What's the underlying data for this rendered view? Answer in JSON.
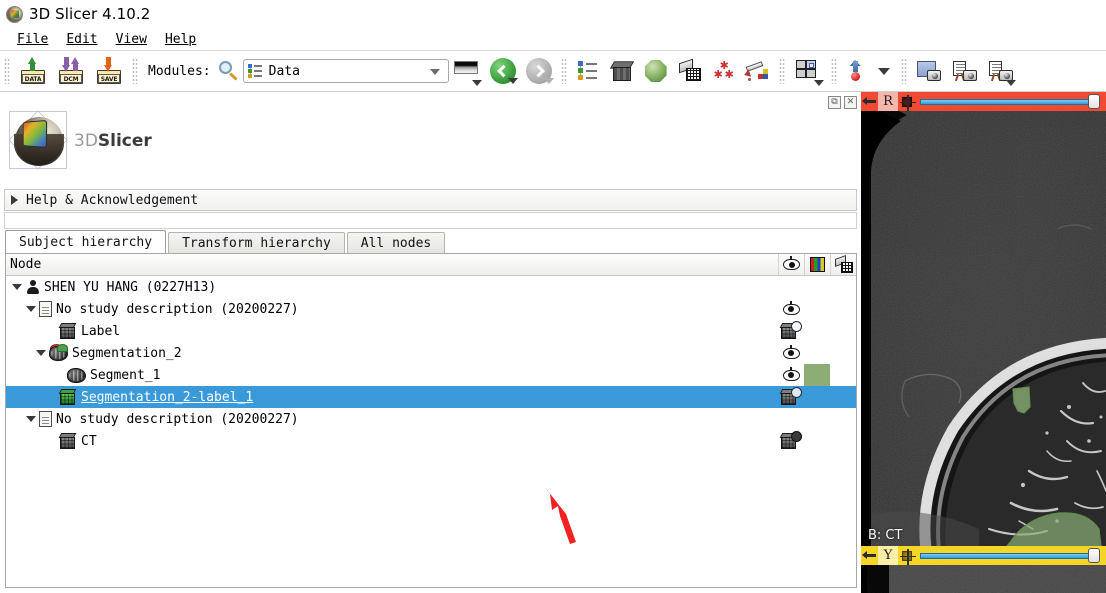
{
  "window": {
    "title": "3D Slicer 4.10.2",
    "app_icon": "slicer-logo-icon"
  },
  "menubar": {
    "items": [
      {
        "label": "File",
        "mnemonic": "F"
      },
      {
        "label": "Edit",
        "mnemonic": "E"
      },
      {
        "label": "View",
        "mnemonic": "V"
      },
      {
        "label": "Help",
        "mnemonic": "H"
      }
    ]
  },
  "toolbar": {
    "load_data_label": "DATA",
    "load_dicom_label": "DCM",
    "save_data_label": "SAVE",
    "modules_label": "Modules:",
    "search_icon": "magnifier-icon",
    "module_selector": {
      "value": "Data",
      "icon": "subject-hierarchy-icon"
    },
    "icons": [
      "colormap-gradient-icon",
      "module-previous-icon",
      "module-next-icon",
      "subject-hierarchy-icon",
      "volume-rendering-icon",
      "models-icon",
      "transforms-icon",
      "markups-icon",
      "segment-editor-icon",
      "layout-selector-icon",
      "crosshair-marker-icon",
      "capture-viewport-icon",
      "screenshot-icon",
      "screen-capture-icon"
    ]
  },
  "module_panel": {
    "restore_button": "restore-panel-icon",
    "close_button": "close-panel-icon",
    "logo": {
      "prefix": "3D",
      "suffix": "Slicer"
    },
    "help_section": {
      "title": "Help & Acknowledgement",
      "expanded": false
    },
    "tabs": [
      {
        "label": "Subject hierarchy",
        "active": true
      },
      {
        "label": "Transform hierarchy",
        "active": false
      },
      {
        "label": "All nodes",
        "active": false
      }
    ],
    "tree": {
      "column_header": "Node",
      "header_icons": [
        "visibility-icon",
        "color-table-icon",
        "transform-icon"
      ],
      "rows": [
        {
          "label": "SHEN YU HANG (0227H13)",
          "indent": 0,
          "icon": "patient-icon",
          "twisty": "expanded",
          "selected": false,
          "right_icon": "none",
          "swatch": ""
        },
        {
          "label": "No study description (20200227)",
          "indent": 1,
          "icon": "study-icon",
          "twisty": "expanded",
          "selected": false,
          "right_icon": "eye-icon",
          "swatch": ""
        },
        {
          "label": "Label",
          "indent": 2,
          "icon": "volume-icon",
          "twisty": "none",
          "selected": false,
          "right_icon": "volume-eye-icon",
          "swatch": ""
        },
        {
          "label": "Segmentation_2",
          "indent": 2,
          "icon": "segmentation-icon",
          "twisty": "expanded",
          "selected": false,
          "right_icon": "eye-icon",
          "swatch": ""
        },
        {
          "label": "Segment_1",
          "indent": 3,
          "icon": "segment-icon",
          "twisty": "none",
          "selected": false,
          "right_icon": "eye-icon",
          "swatch": "#8cae76"
        },
        {
          "label": "Segmentation_2-label_1",
          "indent": 2,
          "icon": "labelmap-icon",
          "twisty": "none",
          "selected": true,
          "right_icon": "volume-eye-icon",
          "swatch": ""
        },
        {
          "label": "No study description (20200227)",
          "indent": 1,
          "icon": "study-icon",
          "twisty": "expanded",
          "selected": false,
          "right_icon": "none",
          "swatch": ""
        },
        {
          "label": "CT",
          "indent": 2,
          "icon": "volume-icon",
          "twisty": "none",
          "selected": false,
          "right_icon": "volume-eye-icon",
          "swatch": ""
        }
      ]
    }
  },
  "slice_view": {
    "top_controller": {
      "letter": "R",
      "color": "#f04a33",
      "pin_icon": "pin-icon",
      "reticle_icon": "slice-offset-icon"
    },
    "bottom_controller": {
      "letter": "Y",
      "color": "#f5d525",
      "pin_icon": "pin-icon",
      "reticle_icon": "slice-offset-icon"
    },
    "corner_label": "B: CT",
    "segmentation_color": "#8cae76"
  },
  "annotation": {
    "arrow_color": "#ee2222",
    "target": "Segmentation_2-label_1"
  },
  "colors": {
    "selection_blue": "#3a9ad9",
    "red_slice": "#f04a33",
    "yellow_slice": "#f5d525",
    "segment_green": "#8cae76"
  }
}
